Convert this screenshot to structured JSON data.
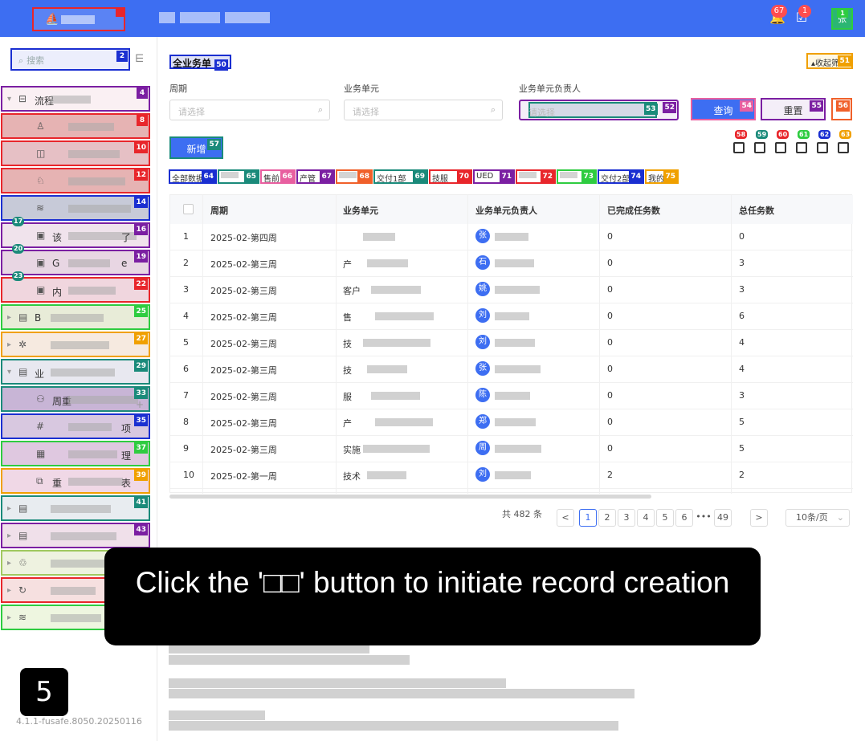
{
  "header": {
    "notify_count": "67",
    "task_count": "1",
    "avatar_tag": "1",
    "avatar_initial": "张"
  },
  "sidebar": {
    "search_placeholder": "搜索",
    "search_tag": "2",
    "items": [
      {
        "label": "流程",
        "tag": "4",
        "color": "#7b1fa2",
        "bg": "#faf0f3",
        "icon": "folder-icon",
        "glyph": "⊟",
        "arrow": "▾"
      },
      {
        "label": "",
        "tag": "8",
        "color": "#e8262b",
        "bg": "#e6b3b3",
        "icon": "user-icon",
        "glyph": "♙"
      },
      {
        "label": "",
        "tag": "10",
        "color": "#e8262b",
        "bg": "#e6c0c5",
        "icon": "book-icon",
        "glyph": "◫"
      },
      {
        "label": "",
        "tag": "12",
        "color": "#e8262b",
        "bg": "#e6b3b3",
        "icon": "user-group-icon",
        "glyph": "♘"
      },
      {
        "label": "",
        "tag": "14",
        "color": "#1a2fd1",
        "bg": "#c7cad8",
        "icon": "layers-icon",
        "glyph": "≋"
      },
      {
        "label": "该",
        "tag": "16",
        "color": "#7b1fa2",
        "bg": "#f0e3ec",
        "icon": "chart-icon",
        "glyph": "▣",
        "subtag": "17",
        "label2": "了"
      },
      {
        "label": "G",
        "tag": "19",
        "color": "#7b1fa2",
        "bg": "#e8d6e3",
        "icon": "chart-icon",
        "glyph": "▣",
        "subtag": "20",
        "label2": "e"
      },
      {
        "label": "内",
        "tag": "22",
        "color": "#e8262b",
        "bg": "#f0d6de",
        "icon": "chart-icon",
        "glyph": "▣",
        "subtag": "23",
        "label2": ""
      },
      {
        "label": "B",
        "tag": "25",
        "color": "#2ecc40",
        "bg": "#e8ecd8",
        "icon": "form-icon",
        "glyph": "▤",
        "arrow": "▸"
      },
      {
        "label": "",
        "tag": "27",
        "color": "#f0a000",
        "bg": "#f6eae0",
        "icon": "settings-icon",
        "glyph": "✲",
        "arrow": "▸"
      },
      {
        "label": "业",
        "tag": "29",
        "color": "#1a8a7a",
        "bg": "#e8e8f0",
        "icon": "form-icon",
        "glyph": "▤",
        "arrow": "▾"
      },
      {
        "label": "周重",
        "tag": "33",
        "color": "#1a8a7a",
        "bg": "#c8b5d6",
        "icon": "team-icon",
        "glyph": "⚇",
        "plus": "+"
      },
      {
        "label": "",
        "tag": "35",
        "color": "#1a2fd1",
        "bg": "#d8c8e0",
        "icon": "hash-icon",
        "glyph": "#",
        "label2": "项"
      },
      {
        "label": "",
        "tag": "37",
        "color": "#2ecc40",
        "bg": "#dfc8e0",
        "icon": "calendar-icon",
        "glyph": "▦",
        "label2": "理"
      },
      {
        "label": "重",
        "tag": "39",
        "color": "#f0a000",
        "bg": "#f0d8e6",
        "icon": "copy-icon",
        "glyph": "⧉",
        "label2": "表"
      },
      {
        "label": "",
        "tag": "41",
        "color": "#1a8a7a",
        "bg": "#e8ecf0",
        "icon": "form-icon",
        "glyph": "▤",
        "arrow": "▸"
      },
      {
        "label": "",
        "tag": "43",
        "color": "#7b1fa2",
        "bg": "#f0e0ea",
        "icon": "form-icon",
        "glyph": "▤",
        "arrow": "▸"
      },
      {
        "label": "",
        "tag": "",
        "color": "#a0c860",
        "bg": "#eef2e0",
        "icon": "recycle-icon",
        "glyph": "♲",
        "arrow": "▸"
      },
      {
        "label": "",
        "tag": "",
        "color": "#e8262b",
        "bg": "#f6e0e0",
        "icon": "refresh-icon",
        "glyph": "↻",
        "arrow": "▸"
      },
      {
        "label": "",
        "tag": "",
        "color": "#2ecc40",
        "bg": "#eef6e0",
        "icon": "layers-icon",
        "glyph": "≋",
        "arrow": "▸"
      }
    ],
    "version": "4.1.1-fusafe.8050.20250116"
  },
  "main": {
    "title": "全业务单",
    "title_tag": "50",
    "collapse_label": "收起筛",
    "collapse_tag": "51",
    "filters": [
      {
        "label": "周期",
        "placeholder": "请选择"
      },
      {
        "label": "业务单元",
        "placeholder": "请选择"
      },
      {
        "label": "业务单元负责人",
        "placeholder": "请选择",
        "tag": "53",
        "tag2": "52"
      }
    ],
    "query_label": "查询",
    "query_tag": "54",
    "reset_label": "重置",
    "reset_tag": "55",
    "extra_tag": "56",
    "add_label": "新增",
    "add_tag": "57",
    "tool_tags": [
      "58",
      "59",
      "60",
      "61",
      "62",
      "63"
    ],
    "tabs": [
      {
        "label": "全部数据",
        "tag": "64",
        "color": "#1a2fd1"
      },
      {
        "label": "",
        "tag": "65",
        "color": "#1a8a7a"
      },
      {
        "label": "售前",
        "tag": "66",
        "color": "#e85fa0"
      },
      {
        "label": "产管",
        "tag": "67",
        "color": "#7b1fa2"
      },
      {
        "label": "",
        "tag": "68",
        "color": "#f0602a"
      },
      {
        "label": "交付1部",
        "tag": "69",
        "color": "#1a8a7a"
      },
      {
        "label": "技服",
        "tag": "70",
        "color": "#e8262b"
      },
      {
        "label": "UED",
        "tag": "71",
        "color": "#7b1fa2"
      },
      {
        "label": "",
        "tag": "72",
        "color": "#e8262b"
      },
      {
        "label": "",
        "tag": "73",
        "color": "#2ecc40"
      },
      {
        "label": "交付2部",
        "tag": "74",
        "color": "#1a2fd1"
      },
      {
        "label": "我的",
        "tag": "75",
        "color": "#f0a000"
      }
    ],
    "columns": [
      "周期",
      "业务单元",
      "业务单元负责人",
      "已完成任务数",
      "总任务数"
    ],
    "rows": [
      {
        "no": "1",
        "period": "2025-02-第四周",
        "unit": "",
        "owner": "张",
        "done": "0",
        "total": "0"
      },
      {
        "no": "2",
        "period": "2025-02-第三周",
        "unit": "产",
        "owner": "石",
        "done": "0",
        "total": "3"
      },
      {
        "no": "3",
        "period": "2025-02-第三周",
        "unit": "客户",
        "owner": "姚",
        "done": "0",
        "total": "3"
      },
      {
        "no": "4",
        "period": "2025-02-第三周",
        "unit": "售",
        "owner": "刘",
        "done": "0",
        "total": "6"
      },
      {
        "no": "5",
        "period": "2025-02-第三周",
        "unit": "技",
        "owner": "刘",
        "done": "0",
        "total": "4"
      },
      {
        "no": "6",
        "period": "2025-02-第三周",
        "unit": "技",
        "owner": "张",
        "done": "0",
        "total": "4"
      },
      {
        "no": "7",
        "period": "2025-02-第三周",
        "unit": "服",
        "owner": "陈",
        "done": "0",
        "total": "3"
      },
      {
        "no": "8",
        "period": "2025-02-第三周",
        "unit": "产",
        "owner": "郑",
        "done": "0",
        "total": "5"
      },
      {
        "no": "9",
        "period": "2025-02-第三周",
        "unit": "实施",
        "owner": "周",
        "done": "0",
        "total": "5"
      },
      {
        "no": "10",
        "period": "2025-02-第一周",
        "unit": "技术",
        "owner": "刘",
        "done": "2",
        "total": "2"
      }
    ],
    "pager": {
      "total": "共 482 条",
      "pages": [
        "1",
        "2",
        "3",
        "4",
        "5",
        "6",
        "•••",
        "49"
      ],
      "prev": "<",
      "next": ">",
      "size": "10条/页"
    }
  },
  "overlay": {
    "instruction": "Click the '□□' button to initiate record creation"
  },
  "step": "5"
}
